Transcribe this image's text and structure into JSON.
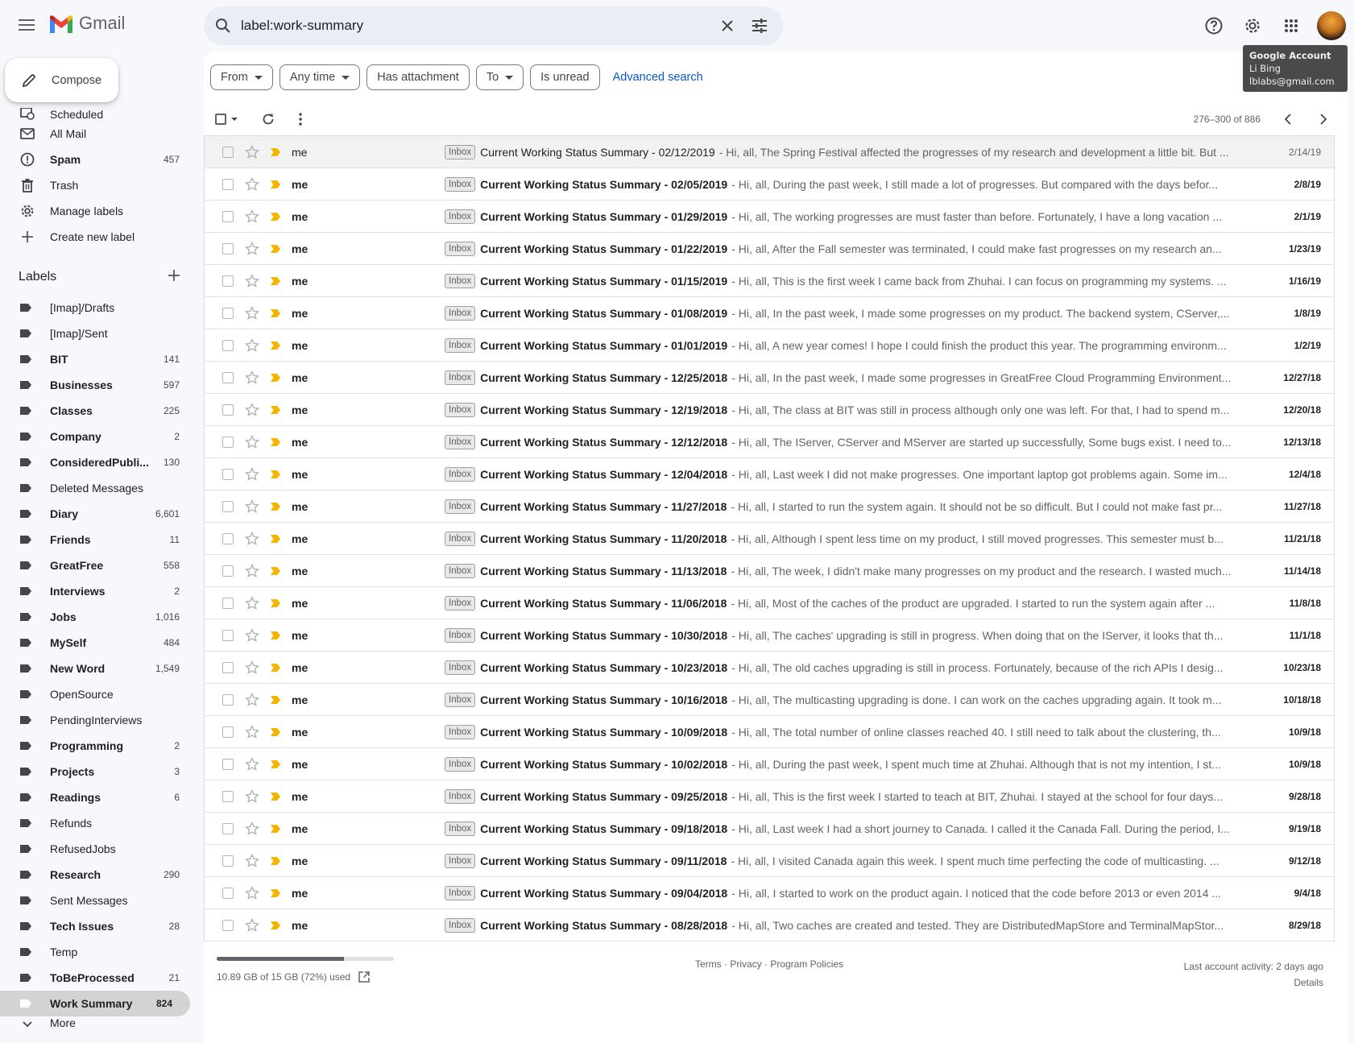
{
  "app": {
    "name": "Gmail"
  },
  "search": {
    "query": "label:work-summary"
  },
  "account": {
    "tooltip_title": "Google Account",
    "name": "Li Bing",
    "email": "lblabs@gmail.com"
  },
  "compose": {
    "label": "Compose"
  },
  "nav": [
    {
      "label": "Scheduled",
      "count": "",
      "icon": "scheduled-icon",
      "bold": false
    },
    {
      "label": "All Mail",
      "count": "",
      "icon": "all-mail-icon",
      "bold": false
    },
    {
      "label": "Spam",
      "count": "457",
      "icon": "spam-icon",
      "bold": true
    },
    {
      "label": "Trash",
      "count": "",
      "icon": "trash-icon",
      "bold": false
    },
    {
      "label": "Manage labels",
      "count": "",
      "icon": "gear-icon",
      "bold": false
    },
    {
      "label": "Create new label",
      "count": "",
      "icon": "plus-icon",
      "bold": false
    }
  ],
  "labels_title": "Labels",
  "labels": [
    {
      "name": "[Imap]/Drafts",
      "count": "",
      "bold": false
    },
    {
      "name": "[Imap]/Sent",
      "count": "",
      "bold": false
    },
    {
      "name": "BIT",
      "count": "141",
      "bold": true
    },
    {
      "name": "Businesses",
      "count": "597",
      "bold": true
    },
    {
      "name": "Classes",
      "count": "225",
      "bold": true
    },
    {
      "name": "Company",
      "count": "2",
      "bold": true
    },
    {
      "name": "ConsideredPubli...",
      "count": "130",
      "bold": true
    },
    {
      "name": "Deleted Messages",
      "count": "",
      "bold": false
    },
    {
      "name": "Diary",
      "count": "6,601",
      "bold": true
    },
    {
      "name": "Friends",
      "count": "11",
      "bold": true
    },
    {
      "name": "GreatFree",
      "count": "558",
      "bold": true
    },
    {
      "name": "Interviews",
      "count": "2",
      "bold": true
    },
    {
      "name": "Jobs",
      "count": "1,016",
      "bold": true
    },
    {
      "name": "MySelf",
      "count": "484",
      "bold": true
    },
    {
      "name": "New Word",
      "count": "1,549",
      "bold": true
    },
    {
      "name": "OpenSource",
      "count": "",
      "bold": false
    },
    {
      "name": "PendingInterviews",
      "count": "",
      "bold": false
    },
    {
      "name": "Programming",
      "count": "2",
      "bold": true
    },
    {
      "name": "Projects",
      "count": "3",
      "bold": true
    },
    {
      "name": "Readings",
      "count": "6",
      "bold": true
    },
    {
      "name": "Refunds",
      "count": "",
      "bold": false
    },
    {
      "name": "RefusedJobs",
      "count": "",
      "bold": false
    },
    {
      "name": "Research",
      "count": "290",
      "bold": true
    },
    {
      "name": "Sent Messages",
      "count": "",
      "bold": false
    },
    {
      "name": "Tech Issues",
      "count": "28",
      "bold": true
    },
    {
      "name": "Temp",
      "count": "",
      "bold": false
    },
    {
      "name": "ToBeProcessed",
      "count": "21",
      "bold": true
    },
    {
      "name": "Work Summary",
      "count": "824",
      "bold": true,
      "active": true
    }
  ],
  "more_label": "More",
  "filters": {
    "from": "From",
    "any_time": "Any time",
    "has_attachment": "Has attachment",
    "to": "To",
    "is_unread": "Is unread",
    "advanced": "Advanced search"
  },
  "pager": {
    "range": "276–300 of 886"
  },
  "badge_label": "Inbox",
  "emails": [
    {
      "sender": "me",
      "subject": "Current Working Status Summary - 02/12/2019",
      "snippet": "- Hi, all, The Spring Festival affected the progresses of my research and development a little bit. But ...",
      "date": "2/14/19",
      "read": true
    },
    {
      "sender": "me",
      "subject": "Current Working Status Summary - 02/05/2019",
      "snippet": "- Hi, all, During the past week, I still made a lot of progresses. But compared with the days befor...",
      "date": "2/8/19",
      "read": false
    },
    {
      "sender": "me",
      "subject": "Current Working Status Summary - 01/29/2019",
      "snippet": "- Hi, all, The working progresses are must faster than before. Fortunately, I have a long vacation ...",
      "date": "2/1/19",
      "read": false
    },
    {
      "sender": "me",
      "subject": "Current Working Status Summary - 01/22/2019",
      "snippet": "- Hi, all, After the Fall semester was terminated, I could make fast progresses on my research an...",
      "date": "1/23/19",
      "read": false
    },
    {
      "sender": "me",
      "subject": "Current Working Status Summary - 01/15/2019",
      "snippet": "- Hi, all, This is the first week I came back from Zhuhai. I can focus on programming my systems. ...",
      "date": "1/16/19",
      "read": false
    },
    {
      "sender": "me",
      "subject": "Current Working Status Summary - 01/08/2019",
      "snippet": "- Hi, all, In the past week, I made some progresses on my product. The backend system, CServer,...",
      "date": "1/8/19",
      "read": false
    },
    {
      "sender": "me",
      "subject": "Current Working Status Summary - 01/01/2019",
      "snippet": "- Hi, all, A new year comes! I hope I could finish the product this year. The programming environm...",
      "date": "1/2/19",
      "read": false
    },
    {
      "sender": "me",
      "subject": "Current Working Status Summary - 12/25/2018",
      "snippet": "- Hi, all, In the past week, I made some progresses in GreatFree Cloud Programming Environment...",
      "date": "12/27/18",
      "read": false
    },
    {
      "sender": "me",
      "subject": "Current Working Status Summary - 12/19/2018",
      "snippet": "- Hi, all, The class at BIT was still in process although only one was left. For that, I had to spend m...",
      "date": "12/20/18",
      "read": false
    },
    {
      "sender": "me",
      "subject": "Current Working Status Summary - 12/12/2018",
      "snippet": "- Hi, all, The IServer, CServer and MServer are started up successfully, Some bugs exist. I need to...",
      "date": "12/13/18",
      "read": false
    },
    {
      "sender": "me",
      "subject": "Current Working Status Summary - 12/04/2018",
      "snippet": "- Hi, all, Last week I did not make progresses. One important laptop got problems again. Some im...",
      "date": "12/4/18",
      "read": false
    },
    {
      "sender": "me",
      "subject": "Current Working Status Summary - 11/27/2018",
      "snippet": "- Hi, all, I started to run the system again. It should not be so difficult. But I could not make fast pr...",
      "date": "11/27/18",
      "read": false
    },
    {
      "sender": "me",
      "subject": "Current Working Status Summary - 11/20/2018",
      "snippet": "- Hi, all, Although I spent less time on my product, I still moved progresses. This semester must b...",
      "date": "11/21/18",
      "read": false
    },
    {
      "sender": "me",
      "subject": "Current Working Status Summary - 11/13/2018",
      "snippet": "- Hi, all, The week, I didn't make many progresses on my product and the research. I wasted much...",
      "date": "11/14/18",
      "read": false
    },
    {
      "sender": "me",
      "subject": "Current Working Status Summary - 11/06/2018",
      "snippet": "- Hi, all, Most of the caches of the product are upgraded. I started to run the system again after ...",
      "date": "11/8/18",
      "read": false
    },
    {
      "sender": "me",
      "subject": "Current Working Status Summary - 10/30/2018",
      "snippet": "- Hi, all, The caches' upgrading is still in progress. When doing that on the IServer, it looks that th...",
      "date": "11/1/18",
      "read": false
    },
    {
      "sender": "me",
      "subject": "Current Working Status Summary - 10/23/2018",
      "snippet": "- Hi, all, The old caches upgrading is still in process. Fortunately, because of the rich APIs I desig...",
      "date": "10/23/18",
      "read": false
    },
    {
      "sender": "me",
      "subject": "Current Working Status Summary - 10/16/2018",
      "snippet": "- Hi, all, The multicasting upgrading is done. I can work on the caches upgrading again. It took m...",
      "date": "10/18/18",
      "read": false
    },
    {
      "sender": "me",
      "subject": "Current Working Status Summary - 10/09/2018",
      "snippet": "- Hi, all, The total number of online classes reached 40. I still need to talk about the clustering, th...",
      "date": "10/9/18",
      "read": false
    },
    {
      "sender": "me",
      "subject": "Current Working Status Summary - 10/02/2018",
      "snippet": "- Hi, all, During the past week, I spent much time at Zhuhai. Although that is not my intention, I st...",
      "date": "10/9/18",
      "read": false
    },
    {
      "sender": "me",
      "subject": "Current Working Status Summary - 09/25/2018",
      "snippet": "- Hi, all, This is the first week I started to teach at BIT, Zhuhai. I stayed at the school for four days...",
      "date": "9/28/18",
      "read": false
    },
    {
      "sender": "me",
      "subject": "Current Working Status Summary - 09/18/2018",
      "snippet": "- Hi, all, Last week I had a short journey to Canada. I called it the Canada Fall. During the period, I...",
      "date": "9/19/18",
      "read": false
    },
    {
      "sender": "me",
      "subject": "Current Working Status Summary - 09/11/2018",
      "snippet": "- Hi, all, I visited Canada again this week. I spent much time perfecting the code of multicasting. ...",
      "date": "9/12/18",
      "read": false
    },
    {
      "sender": "me",
      "subject": "Current Working Status Summary - 09/04/2018",
      "snippet": "- Hi, all, I started to work on the product again. I noticed that the code before 2013 or even 2014 ...",
      "date": "9/4/18",
      "read": false
    },
    {
      "sender": "me",
      "subject": "Current Working Status Summary - 08/28/2018",
      "snippet": "- Hi, all, Two caches are created and tested. They are DistributedMapStore and TerminalMapStor...",
      "date": "8/29/18",
      "read": false
    }
  ],
  "footer": {
    "storage_text": "10.89 GB of 15 GB (72%) used",
    "storage_fraction": 0.72,
    "links": "Terms · Privacy · Program Policies",
    "activity": "Last account activity: 2 days ago",
    "details": "Details"
  },
  "colors": {
    "importance": "#f4b400",
    "accent": "#0b57d0"
  }
}
